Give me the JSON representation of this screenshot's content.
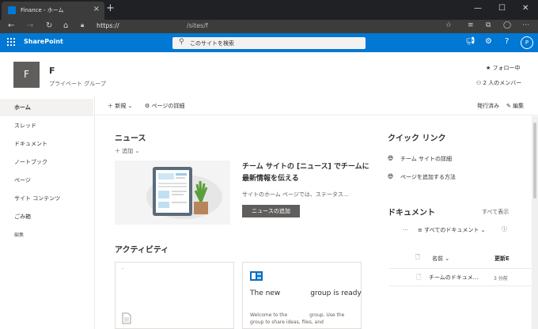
{
  "browser": {
    "tab_title": "Finance - ホーム",
    "tab_close": "×",
    "new_tab": "+",
    "url_prefix": "https://",
    "url_path": "/sites/f",
    "win_minimize": "—",
    "win_maximize": "☐",
    "win_close": "✕"
  },
  "suitebar": {
    "brand": "SharePoint",
    "search_placeholder": "このサイトを検索",
    "avatar_initial": "P"
  },
  "site": {
    "logo_letter": "F",
    "name": "F",
    "subtitle": "プライベート グループ",
    "follow": "フォロー中",
    "members": "2 人のメンバー"
  },
  "leftnav": {
    "items": [
      {
        "label": "ホーム"
      },
      {
        "label": "スレッド"
      },
      {
        "label": "ドキュメント"
      },
      {
        "label": "ノートブック"
      },
      {
        "label": "ページ"
      },
      {
        "label": "サイト コンテンツ"
      },
      {
        "label": "ごみ箱"
      }
    ],
    "edit": "編集"
  },
  "commandbar": {
    "new": "新規",
    "page_details": "ページの詳細",
    "published": "発行済み",
    "edit": "編集"
  },
  "news": {
    "title": "ニュース",
    "add": "追加",
    "headline": "チーム サイトの [ニュース] でチームに最新情報を伝える",
    "body": "サイトのホーム ページでは、ステータス...",
    "add_button": "ニュースの追加"
  },
  "activity": {
    "title": "アクティビティ",
    "card2_title_a": "The new",
    "card2_title_b": "group is ready",
    "card2_body_a": "Welcome to the",
    "card2_body_b": "group. Use the",
    "card2_body_c": "group to share ideas, files, and"
  },
  "quicklinks": {
    "title": "クイック リンク",
    "items": [
      {
        "label": "チーム サイトの詳細"
      },
      {
        "label": "ページを追加する方法"
      }
    ]
  },
  "documents": {
    "title": "ドキュメント",
    "show_all": "すべて表示",
    "more": "…",
    "view": "すべてのドキュメント",
    "col_name": "名前",
    "col_modified": "更新E",
    "rows": [
      {
        "name": "チームのドキュメ...",
        "modified": "3 分前"
      }
    ]
  },
  "colors": {
    "suitebar": "#0078d4",
    "logo_bg": "#605e5c",
    "browser_dark": "#202124"
  }
}
